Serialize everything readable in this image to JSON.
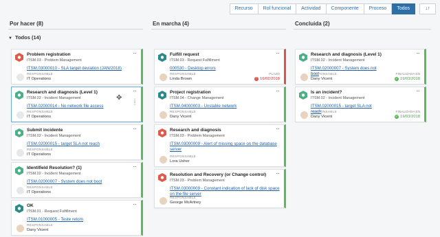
{
  "filters": [
    "Recurso",
    "Rol funcional",
    "Actividad",
    "Componente",
    "Proceso",
    "Todos"
  ],
  "active_filter": "Todos",
  "sort_icon": "sort-icon",
  "columns": [
    {
      "title": "Por hacer (8)"
    },
    {
      "title": "En marcha (4)"
    },
    {
      "title": "Concluida (2)"
    }
  ],
  "group": {
    "label": "Todos (14)"
  },
  "labels": {
    "responsable": "RESPONSABLE",
    "plazo": "PLAZO",
    "finalizada": "FINALIZADA EN"
  },
  "cards": [
    {
      "title": "Problem registration",
      "sub": "ITSM.03 - Problem Management",
      "link": "ITSM.03000010 - SLA target deviation (JAN/2018)",
      "person": "IT Operations",
      "icon": "problem-hexagon-icon",
      "color": "#e05a4b"
    },
    {
      "title": "Research and diagnosis (Level 1)",
      "sub": "ITSM.02 - Incident Management",
      "link": "ITSM.02000014 - No network file access",
      "person": "IT Operations",
      "icon": "incident-hexagon-icon",
      "color": "#4caf86"
    },
    {
      "title": "Submit incidente",
      "sub": "ITSM.02 - Incident Management",
      "link": "ITSM.02000015 - target SLA not reach",
      "person": "IT Operations",
      "icon": "incident-hexagon-icon",
      "color": "#4caf86"
    },
    {
      "title": "Identifield Resolution? (1)",
      "sub": "ITSM.02 - Incident Management",
      "link": "ITSM.02000007 - System does not boot",
      "person": "IT Operations",
      "icon": "incident-hexagon-icon",
      "color": "#4caf86"
    },
    {
      "title": "OK",
      "sub": "ITSM.01 - Request Fulfillment",
      "link": "ITSM.01000005 - Teste retorn",
      "person": "Dany Vicent",
      "icon": "request-hexagon-icon",
      "color": "#2b8a8a"
    },
    {
      "title": "Fulfill request",
      "sub": "ITSM.03 - Request Fulfillment",
      "link": "000530 - Desktop errors",
      "person": "Linda Brown",
      "date": "16/02/2018",
      "icon": "request-hexagon-icon",
      "color": "#2b8a8a"
    },
    {
      "title": "Project registration",
      "sub": "ITSM.04 - Change Management",
      "link": "ITSM.04000003 - Unstable network",
      "person": "Dany Vicent",
      "icon": "change-hexagon-icon",
      "color": "#2b8a8a"
    },
    {
      "title": "Research and diagnosis",
      "sub": "ITSM.03 - Problem Management",
      "link": "ITSM.03000009 - Alert of missing space on the database server",
      "person": "Lora Usher",
      "icon": "problem-hexagon-icon",
      "color": "#e05a4b"
    },
    {
      "title": "Resolution and Recovery (or Change control)",
      "sub": "ITSM.03 - Problem Management",
      "link": "ITSM.03000009 - Constant indication of lack of disk space on the file server",
      "person": "George McArtney",
      "icon": "problem-hexagon-icon",
      "color": "#e05a4b"
    },
    {
      "title": "Research and diagnosis (Level 1)",
      "sub": "ITSM.02 - Incident Management",
      "link": "ITSM.02000007 - System does not boot",
      "person": "Dany Vicent",
      "date": "19/03/2018",
      "icon": "incident-hexagon-icon",
      "color": "#4caf86"
    },
    {
      "title": "Is an incident?",
      "sub": "ITSM.02 - Incident Management",
      "link": "ITSM.02000015 - target SLA not reach",
      "person": "Dany Vicent",
      "date": "19/03/2018",
      "icon": "incident-hexagon-icon",
      "color": "#4caf86"
    }
  ]
}
